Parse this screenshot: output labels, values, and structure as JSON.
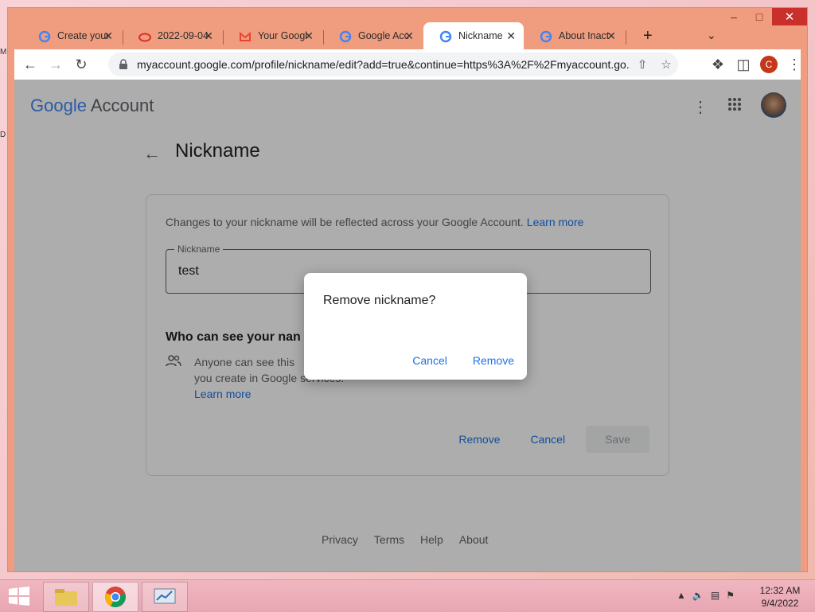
{
  "browser": {
    "tabs": [
      {
        "title": "Create your",
        "favicon": "google-g-icon"
      },
      {
        "title": "2022-09-04",
        "favicon": "red-cloud-icon"
      },
      {
        "title": "Your Googl",
        "favicon": "gmail-icon"
      },
      {
        "title": "Google Acc",
        "favicon": "google-g-icon"
      },
      {
        "title": "Nickname",
        "favicon": "google-g-icon",
        "active": true
      },
      {
        "title": "About Inact",
        "favicon": "google-g-icon"
      }
    ],
    "url": "myaccount.google.com/profile/nickname/edit?add=true&continue=https%3A%2F%2Fmyaccount.go...",
    "profile_initial": "C"
  },
  "header": {
    "logo_google": "Google",
    "logo_account": "Account"
  },
  "page": {
    "title": "Nickname",
    "description": "Changes to your nickname will be reflected across your Google Account.",
    "learn_more": "Learn more",
    "field_label": "Nickname",
    "field_value": "test",
    "who_heading": "Who can see your nan",
    "who_text": "Anyone can see this                      you or view content you create in Google services.",
    "who_learn_more": "Learn more",
    "remove_label": "Remove",
    "cancel_label": "Cancel",
    "save_label": "Save"
  },
  "footer": {
    "privacy": "Privacy",
    "terms": "Terms",
    "help": "Help",
    "about": "About"
  },
  "dialog": {
    "title": "Remove nickname?",
    "cancel": "Cancel",
    "remove": "Remove"
  },
  "taskbar": {
    "time": "12:32 AM",
    "date": "9/4/2022"
  },
  "desktop": {
    "stub1": "M",
    "stub2": "D"
  },
  "colors": {
    "accent": "#1a73e8",
    "window_frame": "#ef9d7e",
    "close_red": "#c9302c"
  }
}
